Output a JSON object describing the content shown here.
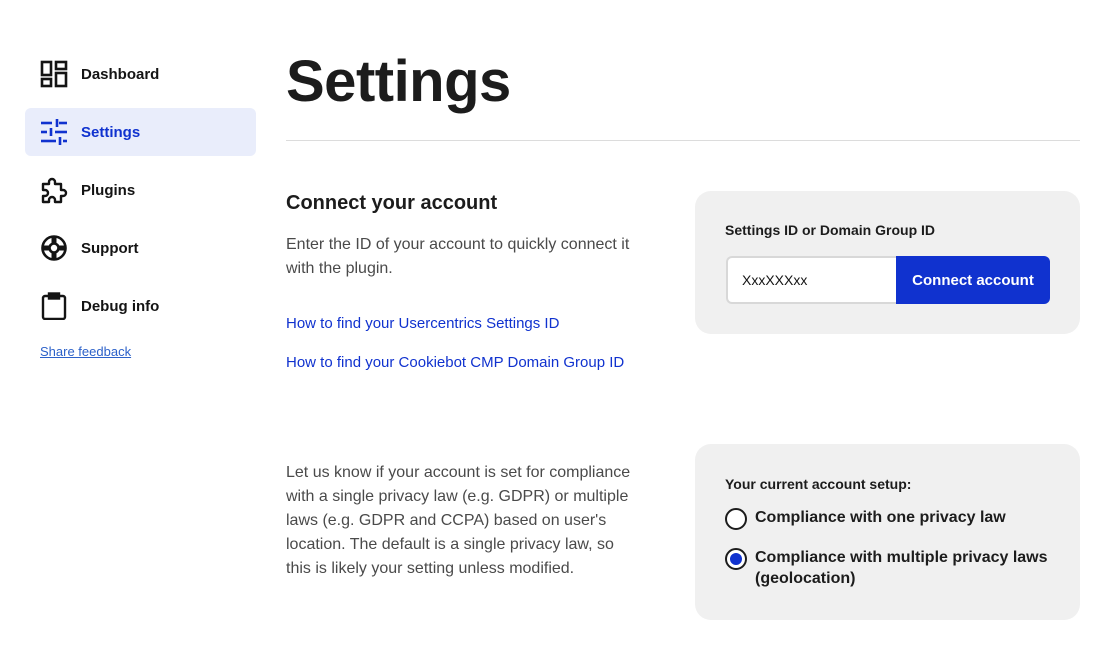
{
  "sidebar": {
    "items": [
      {
        "label": "Dashboard",
        "icon": "dashboard-icon"
      },
      {
        "label": "Settings",
        "icon": "sliders-icon",
        "active": true
      },
      {
        "label": "Plugins",
        "icon": "puzzle-icon"
      },
      {
        "label": "Support",
        "icon": "lifebuoy-icon"
      },
      {
        "label": "Debug info",
        "icon": "clipboard-icon"
      }
    ],
    "share_feedback": "Share feedback"
  },
  "main": {
    "title": "Settings",
    "connect": {
      "title": "Connect your account",
      "description": "Enter the ID of your account to quickly connect it with the plugin.",
      "link_usercentrics": "How to find your Usercentrics Settings ID",
      "link_cookiebot": "How to find your Cookiebot CMP Domain Group ID",
      "field_label": "Settings ID or Domain Group ID",
      "input_value": "XxxXXXxx",
      "button_label": "Connect account"
    },
    "compliance": {
      "description": "Let us know if your account is set for compliance with a single privacy law (e.g. GDPR) or multiple laws (e.g. GDPR and CCPA) based on user's location. The default is a single privacy law, so this is likely your setting unless modified.",
      "setup_label": "Your current account setup:",
      "options": [
        {
          "label": "Compliance with one privacy law",
          "checked": false
        },
        {
          "label": "Compliance with multiple privacy laws (geolocation)",
          "checked": true
        }
      ]
    }
  },
  "colors": {
    "accent": "#1032cf",
    "active_nav_bg": "#e9edfb",
    "card_bg": "#f0f0f0",
    "link": "#1032cf"
  }
}
